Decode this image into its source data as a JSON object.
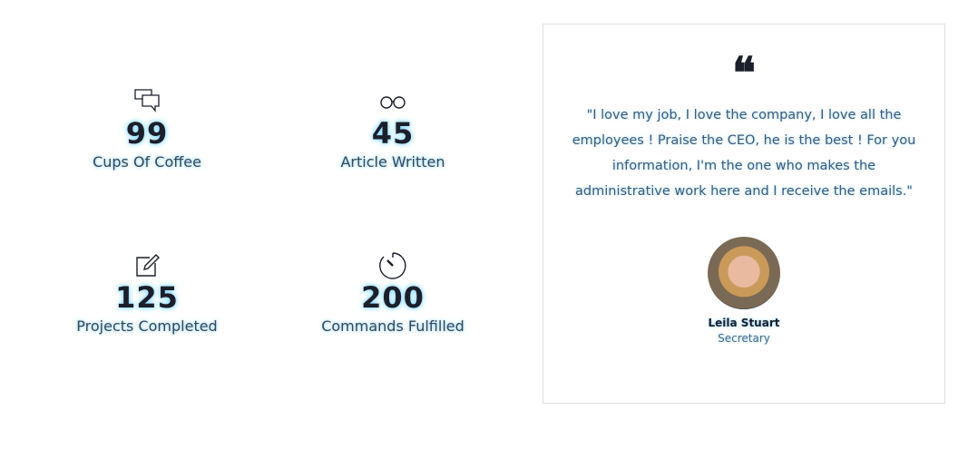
{
  "stats": [
    {
      "icon": "chat-bubbles-icon",
      "value": "99",
      "label": "Cups Of Coffee"
    },
    {
      "icon": "glasses-icon",
      "value": "45",
      "label": "Article Written"
    },
    {
      "icon": "edit-icon",
      "value": "125",
      "label": "Projects Completed"
    },
    {
      "icon": "timer-icon",
      "value": "200",
      "label": "Commands Fulfilled"
    }
  ],
  "testimonial": {
    "icon": "quote-icon",
    "quote": "\"I love my job, I love the company, I love all the employees ! Praise the CEO, he is the best ! For you information, I'm the one who makes the administrative work here and I receive the emails.\"",
    "name": "Leila Stuart",
    "role": "Secretary"
  },
  "colors": {
    "glow": "#7fd3ff",
    "text": "#1b1f2a"
  }
}
